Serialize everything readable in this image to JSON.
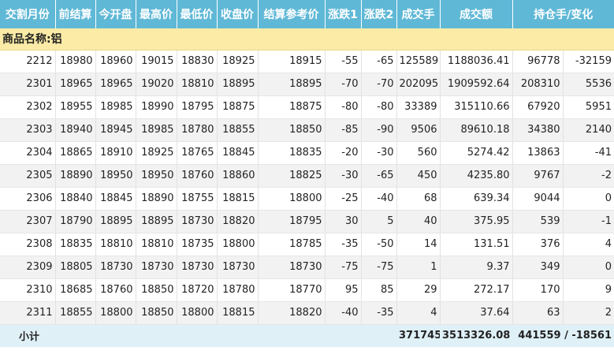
{
  "headers": [
    "交割月份",
    "前结算",
    "今开盘",
    "最高价",
    "最低价",
    "收盘价",
    "结算参考价",
    "涨跌1",
    "涨跌2",
    "成交手",
    "成交额",
    "持仓手/变化"
  ],
  "section_title": "商品名称:铝",
  "rows": [
    [
      "2212",
      "18980",
      "18960",
      "19015",
      "18830",
      "18925",
      "18915",
      "-55",
      "-65",
      "125589",
      "1188036.41",
      "96778",
      "-32159"
    ],
    [
      "2301",
      "18965",
      "18965",
      "19020",
      "18810",
      "18895",
      "18895",
      "-70",
      "-70",
      "202095",
      "1909592.64",
      "208310",
      "5536"
    ],
    [
      "2302",
      "18955",
      "18985",
      "18990",
      "18795",
      "18875",
      "18875",
      "-80",
      "-80",
      "33389",
      "315110.66",
      "67920",
      "5951"
    ],
    [
      "2303",
      "18940",
      "18945",
      "18985",
      "18780",
      "18855",
      "18850",
      "-85",
      "-90",
      "9506",
      "89610.18",
      "34380",
      "2140"
    ],
    [
      "2304",
      "18865",
      "18910",
      "18925",
      "18765",
      "18845",
      "18835",
      "-20",
      "-30",
      "560",
      "5274.42",
      "13863",
      "-41"
    ],
    [
      "2305",
      "18890",
      "18950",
      "18950",
      "18760",
      "18860",
      "18825",
      "-30",
      "-65",
      "450",
      "4235.80",
      "9767",
      "-2"
    ],
    [
      "2306",
      "18840",
      "18845",
      "18890",
      "18755",
      "18815",
      "18800",
      "-25",
      "-40",
      "68",
      "639.34",
      "9044",
      "0"
    ],
    [
      "2307",
      "18790",
      "18895",
      "18895",
      "18730",
      "18820",
      "18795",
      "30",
      "5",
      "40",
      "375.95",
      "539",
      "-1"
    ],
    [
      "2308",
      "18835",
      "18810",
      "18810",
      "18735",
      "18800",
      "18785",
      "-35",
      "-50",
      "14",
      "131.51",
      "376",
      "4"
    ],
    [
      "2309",
      "18805",
      "18730",
      "18730",
      "18730",
      "18730",
      "18730",
      "-75",
      "-75",
      "1",
      "9.37",
      "349",
      "0"
    ],
    [
      "2310",
      "18685",
      "18760",
      "18850",
      "18720",
      "18780",
      "18770",
      "95",
      "85",
      "29",
      "272.17",
      "170",
      "9"
    ],
    [
      "2311",
      "18855",
      "18800",
      "18850",
      "18800",
      "18815",
      "18820",
      "-40",
      "-35",
      "4",
      "37.64",
      "63",
      "2"
    ]
  ],
  "subtotal": {
    "label": "小计",
    "volume": "371745",
    "turnover": "3513326.08",
    "open_interest_change": "441559 / -18561"
  },
  "colors": {
    "header_bg": "#5fb8d6",
    "section_bg": "#fbeba6",
    "footer_bg": "#dff0f7",
    "alt_row_bg": "#f2f2f2"
  }
}
